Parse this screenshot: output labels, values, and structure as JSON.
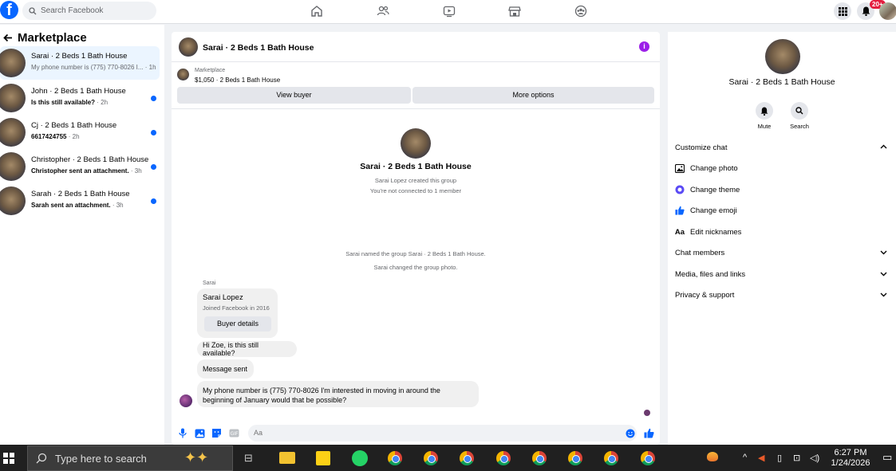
{
  "topbar": {
    "logo": "f",
    "search_placeholder": "Search Facebook",
    "notifications_badge": "20+"
  },
  "sidebar": {
    "title": "Marketplace",
    "conversations": [
      {
        "name": "Sarai · 2 Beds 1 Bath House",
        "snippet": "My phone number is (775) 770-8026 I...",
        "time": "· 1h",
        "unread": false,
        "active": true
      },
      {
        "name": "John · 2 Beds 1 Bath House",
        "snippet": "Is this still available?",
        "time": "· 2h",
        "unread": true,
        "active": false
      },
      {
        "name": "Cj · 2 Beds 1 Bath House",
        "snippet": "6617424755",
        "time": "· 2h",
        "unread": true,
        "active": false
      },
      {
        "name": "Christopher · 2 Beds 1 Bath House",
        "snippet": "Christopher sent an attachment.",
        "time": "· 3h",
        "unread": true,
        "active": false
      },
      {
        "name": "Sarah · 2 Beds 1 Bath House",
        "snippet": "Sarah sent an attachment.",
        "time": "· 3h",
        "unread": true,
        "active": false
      }
    ]
  },
  "chat": {
    "title": "Sarai · 2 Beds 1 Bath House",
    "marketplace_label": "Marketplace",
    "listing": "$1,050 · 2 Beds 1 Bath House",
    "view_buyer": "View buyer",
    "more_options": "More options",
    "intro_title": "Sarai · 2 Beds 1 Bath House",
    "intro_line1": "Sarai Lopez created this group",
    "intro_line2": "You're not connected to 1 member",
    "sys1": "Sarai named the group Sarai · 2 Beds 1 Bath House.",
    "sys2": "Sarai changed the group photo.",
    "sender": "Sarai",
    "card_name": "Sarai Lopez",
    "card_sub": "Joined Facebook in 2016",
    "card_button": "Buyer details",
    "msg1": "Hi Zoe, is this still available?",
    "msg2": "Message sent",
    "msg3": "My phone number is (775) 770-8026 I'm interested in moving in around the beginning of January would that be possible?",
    "input_placeholder": "Aa"
  },
  "right_panel": {
    "title": "Sarai · 2 Beds 1 Bath House",
    "mute": "Mute",
    "search": "Search",
    "customize_chat": "Customize chat",
    "change_photo": "Change photo",
    "change_theme": "Change theme",
    "change_emoji": "Change emoji",
    "nickname_icon": "Aa",
    "edit_nicknames": "Edit nicknames",
    "chat_members": "Chat members",
    "media": "Media, files and links",
    "privacy": "Privacy & support"
  },
  "taskbar": {
    "search_placeholder": "Type here to search",
    "time": "6:27 PM",
    "date": "1/24/2026"
  },
  "colors": {
    "brand": "#0866ff",
    "theme_purple": "#9b1fe8",
    "unread_dot": "#0866ff"
  }
}
